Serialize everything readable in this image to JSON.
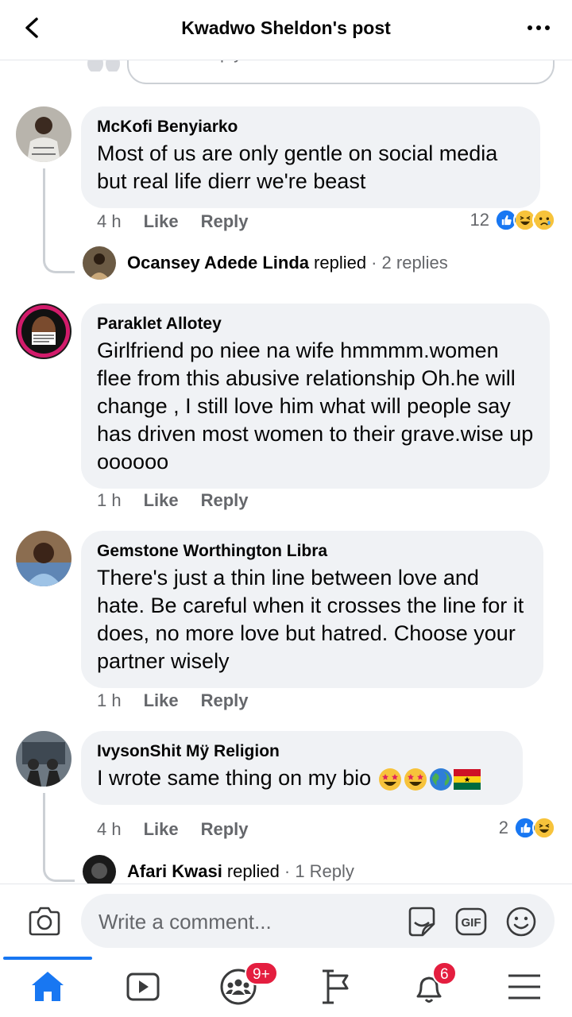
{
  "header": {
    "title": "Kwadwo Sheldon's post"
  },
  "reply_box": {
    "placeholder": "Write a reply..."
  },
  "comments": [
    {
      "author": "McKofi Benyiarko",
      "text": "Most of  us are only gentle on social media but real life dierr  we're beast",
      "time": "4 h",
      "like_label": "Like",
      "reply_label": "Reply",
      "reaction_count": "12",
      "reactions": [
        "like-icon",
        "haha-icon",
        "sad-icon"
      ],
      "replies": {
        "name": "Ocansey Adede Linda",
        "verb": "replied",
        "count": "· 2 replies"
      }
    },
    {
      "author": "Paraklet Allotey",
      "text": "Girlfriend  po niee na wife hmmmm.women flee from this abusive  relationship  Oh.he will change , I still love him  what will people say has driven most women to their grave.wise up oooooo",
      "time": "1 h",
      "like_label": "Like",
      "reply_label": "Reply"
    },
    {
      "author": "Gemstone Worthington Libra",
      "text": "There's just a thin line between love and hate. Be careful when it crosses the line for it does, no more love but hatred. Choose your partner wisely",
      "time": "1 h",
      "like_label": "Like",
      "reply_label": "Reply"
    },
    {
      "author": "IvysonShit Mÿ Religion",
      "text": "I wrote same thing on my bio",
      "emojis": [
        "star-struck-emoji",
        "star-struck-emoji",
        "globe-emoji",
        "ghana-flag-emoji"
      ],
      "time": "4 h",
      "like_label": "Like",
      "reply_label": "Reply",
      "reaction_count": "2",
      "reactions": [
        "like-icon",
        "haha-icon"
      ],
      "replies": {
        "name": "Afari Kwasi",
        "verb": "replied",
        "count": "· 1 Reply"
      }
    }
  ],
  "composer": {
    "placeholder": "Write a comment..."
  },
  "tabbar": {
    "groups_badge": "9+",
    "notifications_badge": "6"
  },
  "colors": {
    "accent": "#1877f2",
    "badge": "#e41e3f",
    "bubble": "#f0f2f5",
    "meta": "#65676b"
  }
}
